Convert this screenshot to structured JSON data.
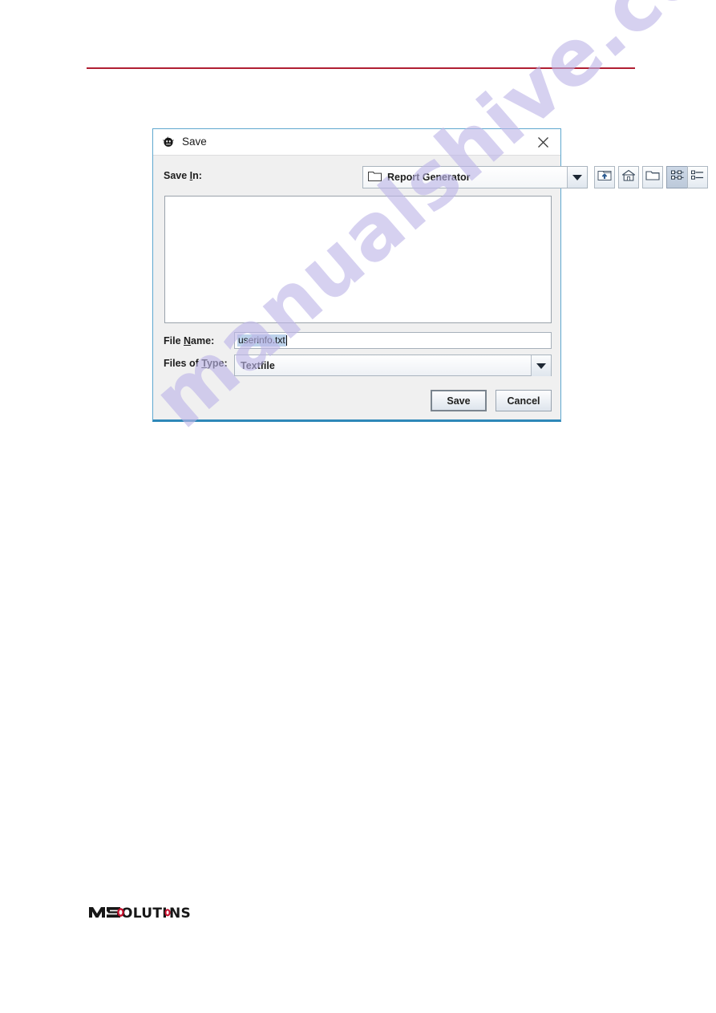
{
  "page": {
    "rule_color": "#b01f33",
    "background": "#ffffff"
  },
  "watermark": {
    "text": "manualshive.com",
    "color": "#bdb6e8"
  },
  "dialog": {
    "title": "Save",
    "title_icon": "java-duke-icon",
    "close_icon": "close-icon",
    "border_color": "#5fa8cf",
    "accent_color": "#2e88b8",
    "save_in": {
      "label_before": "Save ",
      "label_accel": "I",
      "label_after": "n:",
      "label_full": "Save In:",
      "value": "Report Generator",
      "folder_icon": "folder-icon",
      "dropdown_icon": "chevron-down-icon"
    },
    "toolbar": [
      {
        "name": "up-one-level-button",
        "icon": "folder-up-icon",
        "selected": false
      },
      {
        "name": "home-button",
        "icon": "home-icon",
        "selected": false
      },
      {
        "name": "create-new-folder-button",
        "icon": "new-folder-icon",
        "selected": false
      },
      {
        "name": "list-view-button",
        "icon": "grid-view-icon",
        "selected": true
      },
      {
        "name": "details-view-button",
        "icon": "details-view-icon",
        "selected": false
      }
    ],
    "file_list": {
      "items": [],
      "background": "#ffffff"
    },
    "file_name": {
      "label_before": "File ",
      "label_accel": "N",
      "label_after": "ame:",
      "label_full": "File Name:",
      "value": "userinfo.txt",
      "placeholder": "",
      "selected": true,
      "selection_color": "#bcd2ea"
    },
    "files_of_type": {
      "label_before": "Files of ",
      "label_accel": "T",
      "label_after": "ype:",
      "label_full": "Files of Type:",
      "value": "Textfile",
      "options": [
        "Textfile"
      ],
      "dropdown_icon": "chevron-down-icon"
    },
    "buttons": {
      "save_label": "Save",
      "cancel_label": "Cancel",
      "default_button": "Save"
    }
  },
  "footer": {
    "logo_text_m": "M",
    "logo_text_s": "S",
    "logo_text_rest": "OLUTIONS",
    "logo_accent_color": "#c8102e",
    "logo_color": "#1a1a1a"
  }
}
